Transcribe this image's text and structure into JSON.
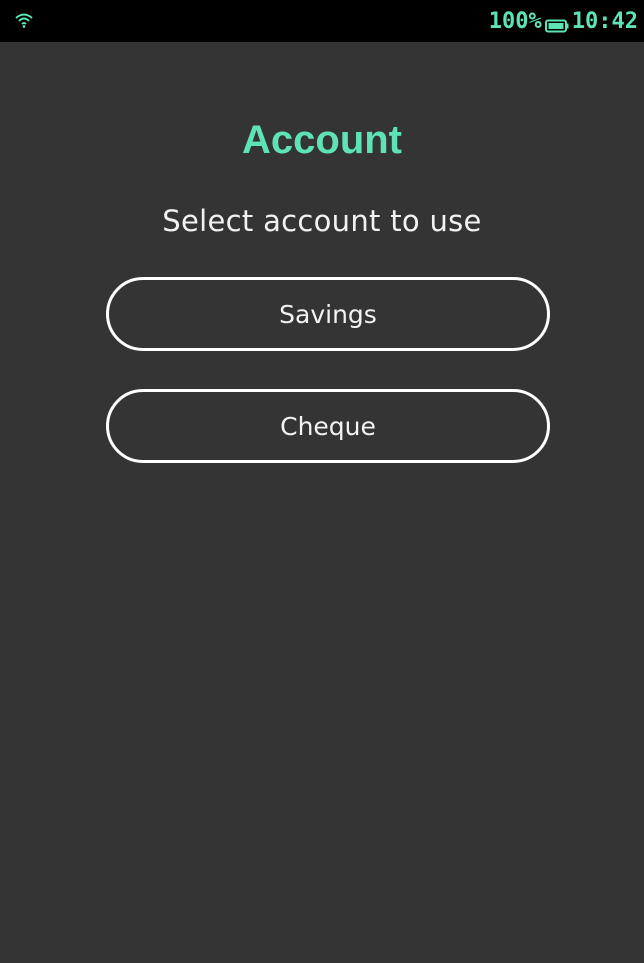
{
  "status_bar": {
    "wifi_icon": "wifi-icon",
    "battery_percent": "100%",
    "battery_icon": "battery-icon",
    "time": "10:42"
  },
  "screen": {
    "title": "Account",
    "subtitle": "Select account to use",
    "options": [
      {
        "label": "Savings"
      },
      {
        "label": "Cheque"
      }
    ]
  },
  "colors": {
    "background": "#343434",
    "status_bar": "#000000",
    "accent": "#5ee3b4",
    "text": "#f2f2f2",
    "button_border": "#ffffff"
  }
}
